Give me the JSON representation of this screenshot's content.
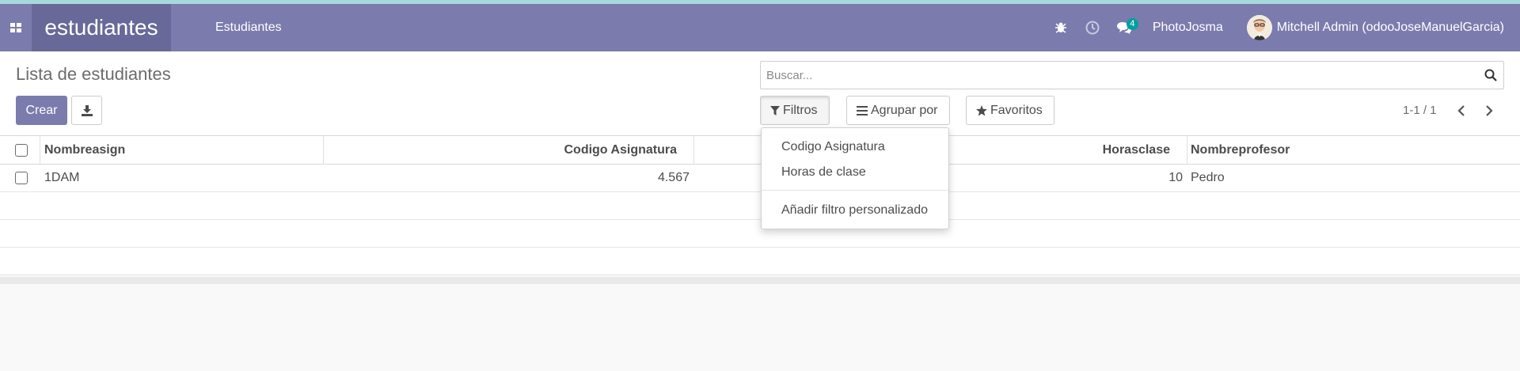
{
  "navbar": {
    "app_name": "estudiantes",
    "menu_item": "Estudiantes",
    "messages_count": "4",
    "company": "PhotoJosma",
    "user": "Mitchell Admin (odooJoseManuelGarcia)"
  },
  "control_panel": {
    "title": "Lista de estudiantes",
    "create_label": "Crear",
    "search_placeholder": "Buscar...",
    "filters_label": "Filtros",
    "groupby_label": "Agrupar por",
    "favorites_label": "Favoritos",
    "pager": "1-1 / 1"
  },
  "filters_menu": {
    "items": [
      "Codigo Asignatura",
      "Horas de clase"
    ],
    "custom": "Añadir filtro personalizado"
  },
  "table": {
    "columns": [
      "Nombreasign",
      "Codigo Asignatura",
      "Horasclase",
      "Nombreprofesor"
    ],
    "rows": [
      {
        "nombreasign": "1DAM",
        "codigo": "4.567",
        "horas": "10",
        "profesor": "Pedro"
      }
    ]
  },
  "colors": {
    "navbar": "#7c7bad",
    "brand": "#686899",
    "primary_button": "#7c7bad",
    "badge": "#00a09d"
  },
  "icons": [
    "apps-grid-icon",
    "bug-icon",
    "clock-icon",
    "chat-icon",
    "download-icon",
    "search-icon",
    "filter-icon",
    "list-icon",
    "star-icon",
    "chevron-left-icon",
    "chevron-right-icon"
  ]
}
